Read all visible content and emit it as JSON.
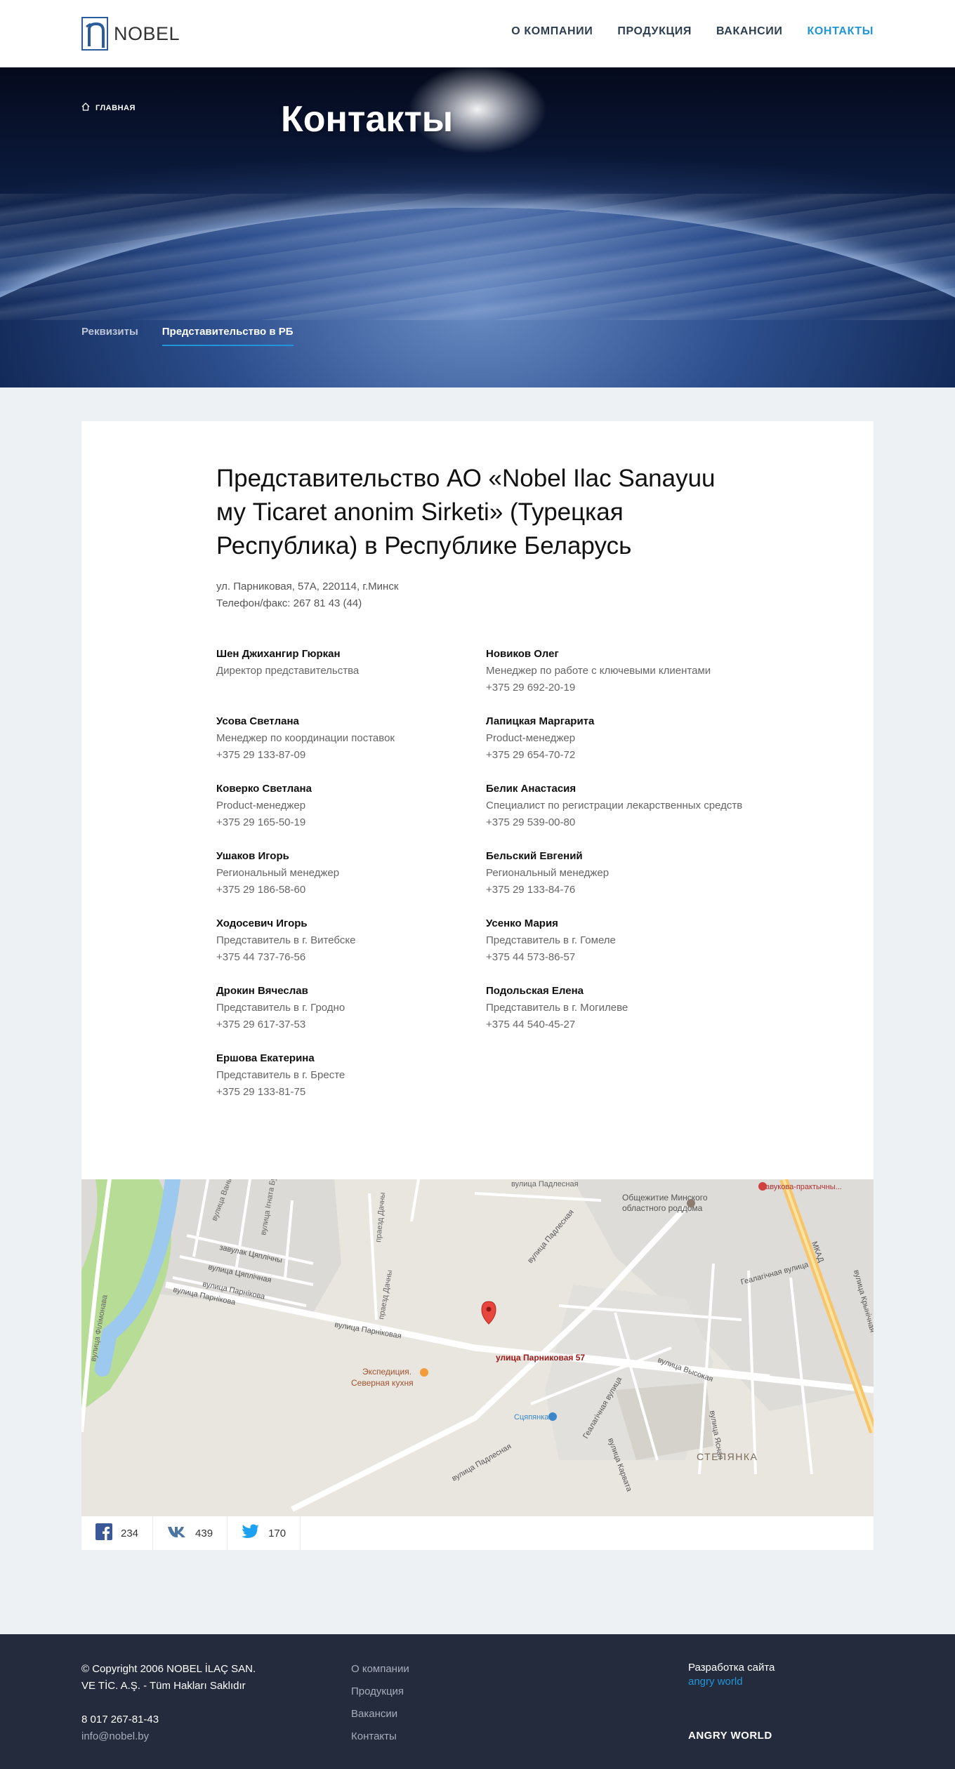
{
  "header": {
    "logo_text": "NOBEL",
    "nav": [
      {
        "label": "О КОМПАНИИ"
      },
      {
        "label": "ПРОДУКЦИЯ"
      },
      {
        "label": "ВАКАНСИИ"
      },
      {
        "label": "КОНТАКТЫ",
        "active": true
      }
    ],
    "accent_color": "#2196d6"
  },
  "hero": {
    "breadcrumb": "ГЛАВНАЯ",
    "title": "Контакты",
    "tabs": [
      {
        "label": "Реквизиты"
      },
      {
        "label": "Представительство в РБ",
        "active": true
      }
    ]
  },
  "content": {
    "heading": "Представительство АО «Nobel Ilac Sanayuu му Ticaret anonim Sirketi» (Турецкая Республика) в Республике Беларусь",
    "address": "ул. Парниковая, 57А, 220114, г.Минск",
    "phone": "Телефон/факс: 267 81 43 (44)",
    "contacts": [
      {
        "name": "Шен Джихангир Гюркан",
        "position": "Директор представительства",
        "phone": ""
      },
      {
        "name": "Новиков Олег",
        "position": "Менеджер по работе с ключевыми клиентами",
        "phone": "+375 29 692-20-19"
      },
      {
        "name": "Усова Светлана",
        "position": "Менеджер по координации поставок",
        "phone": "+375 29 133-87-09"
      },
      {
        "name": "Лапицкая Маргарита",
        "position": "Product-менеджер",
        "phone": "+375 29 654-70-72"
      },
      {
        "name": "Коверко Светлана",
        "position": "Product-менеджер",
        "phone": "+375 29 165-50-19"
      },
      {
        "name": "Белик Анастасия",
        "position": "Специалист по регистрации лекарственных средств",
        "phone": "+375 29 539-00-80"
      },
      {
        "name": "Ушаков Игорь",
        "position": "Региональный менеджер",
        "phone": "+375 29 186-58-60"
      },
      {
        "name": "Бельский Евгений",
        "position": "Региональный менеджер",
        "phone": "+375 29 133-84-76"
      },
      {
        "name": "Ходосевич Игорь",
        "position": "Представитель в г. Витебске",
        "phone": "+375 44 737-76-56"
      },
      {
        "name": "Усенко Мария",
        "position": "Представитель в г. Гомеле",
        "phone": "+375 44 573-86-57"
      },
      {
        "name": "Дрокин Вячеслав",
        "position": "Представитель в г. Гродно",
        "phone": "+375 29 617-37-53"
      },
      {
        "name": "Подольская Елена",
        "position": "Представитель в г. Могилеве",
        "phone": "+375 44 540-45-27"
      },
      {
        "name": "Ершова Екатерина",
        "position": "Представитель в г. Бресте",
        "phone": "+375 29 133-81-75"
      }
    ]
  },
  "map": {
    "marker_label": "улица Парниковая 57",
    "labels": {
      "dormitory": "Общежитие Минского",
      "dormitory2": "областного роддома",
      "hospital": "навукова-практычны...",
      "padlesnaya_top": "вулица Падлесная",
      "mkad": "МКАД",
      "filimonova": "вулица Філімонава",
      "vankovicha": "вулица Ваньковіча",
      "ignata_bu": "вулица Ігната Бу",
      "dachny": "праезд Дачны",
      "dachny2": "праезд Дачны",
      "tsyalinny_lane": "завулак Цяплічны",
      "tsyalinnaya": "вулица Цяплічная",
      "parnikovaya1": "вулица Парнікова",
      "parnikovaya2": "вулица Парнікова",
      "parnikovaya3": "вулица Парніковая",
      "parnikovaya4": "вулица Парніковая",
      "padlesnaya2": "вулица Падлесная",
      "padlesnaya3": "вулица Падлесная",
      "hevalagichnaya": "Геалагічная вулица",
      "hevalagichnaya2": "Геалагічная вулица",
      "krynichnaya": "вулица Крынічная",
      "vysokaya": "вулица Высокая",
      "yasnaya": "вулица Ясная",
      "karavata": "вулица Карвата",
      "stepyanka": "СТЕПЯНКА",
      "expedition": "Экспедиция.",
      "expedition2": "Северная кухня",
      "tsiplyanka": "Сцяпянка"
    }
  },
  "social": [
    {
      "name": "facebook",
      "count": "234",
      "color": "#3b5998"
    },
    {
      "name": "vk",
      "count": "439",
      "color": "#4c75a3"
    },
    {
      "name": "twitter",
      "count": "170",
      "color": "#1da1f2"
    }
  ],
  "footer": {
    "copyright_line1": "© Copyright 2006 NOBEL İLAÇ SAN.",
    "copyright_line2": "VE TİC. A.Ş. - Tüm Hakları Saklıdır",
    "phone": "8 017 267-81-43",
    "email": "info@nobel.by",
    "links": [
      "О компании",
      "Продукция",
      "Вакансии",
      "Контакты"
    ],
    "dev_label": "Разработка сайта",
    "dev_link": "angry world",
    "brand": "ANGRY WORLD"
  }
}
